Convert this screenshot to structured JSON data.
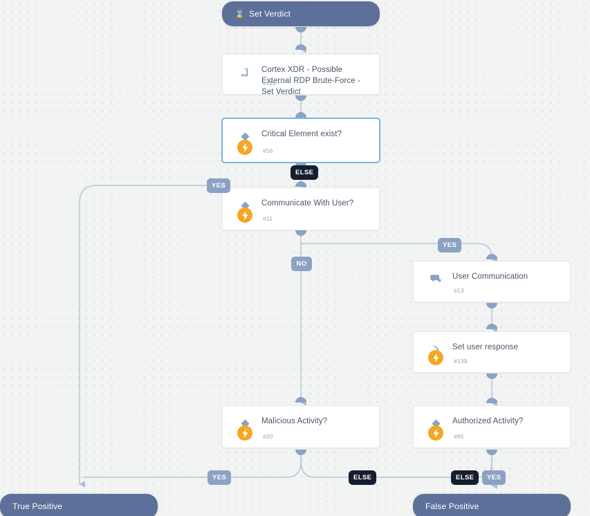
{
  "canvas": {
    "background_color": "#f2f4f3",
    "grid_dot_color": "#dcdfde",
    "edge_color": "#b8c9dd"
  },
  "start_node": {
    "label": "Set Verdict",
    "icon": "hourglass-icon",
    "color": "#5d7099"
  },
  "nodes": [
    {
      "id": "playbook-task",
      "title": "Cortex XDR - Possible External RDP Brute-Force - Set Verdict",
      "task_id": "#111",
      "icon": "playbook-book-icon",
      "has_bolt": false,
      "selected": false
    },
    {
      "id": "critical-element",
      "title": "Critical Element exist?",
      "task_id": "#56",
      "icon": "condition-diamond-icon",
      "has_bolt": true,
      "selected": true
    },
    {
      "id": "communicate-with-user",
      "title": "Communicate With User?",
      "task_id": "#11",
      "icon": "condition-diamond-icon",
      "has_bolt": true,
      "selected": false
    },
    {
      "id": "user-communication",
      "title": "User Communication",
      "task_id": "#13",
      "icon": "chat-bubble-icon",
      "has_bolt": false,
      "selected": false
    },
    {
      "id": "set-user-response",
      "title": "Set user response",
      "task_id": "#139",
      "icon": "chevron-right-icon",
      "has_bolt": true,
      "selected": false
    },
    {
      "id": "malicious-activity",
      "title": "Malicious Activity?",
      "task_id": "#20",
      "icon": "condition-diamond-icon",
      "has_bolt": true,
      "selected": false
    },
    {
      "id": "authorized-activity",
      "title": "Authorized Activity?",
      "task_id": "#85",
      "icon": "condition-diamond-icon",
      "has_bolt": true,
      "selected": false
    }
  ],
  "end_nodes": [
    {
      "id": "true-positive",
      "label": "True Positive",
      "color": "#5d7099"
    },
    {
      "id": "false-positive",
      "label": "False Positive",
      "color": "#5d7099"
    }
  ],
  "branch_badges": [
    {
      "id": "else-critical",
      "label": "ELSE",
      "kind": "else"
    },
    {
      "id": "yes-critical",
      "label": "YES",
      "kind": "yes"
    },
    {
      "id": "no-communicate",
      "label": "NO",
      "kind": "no"
    },
    {
      "id": "yes-communicate",
      "label": "YES",
      "kind": "yes"
    },
    {
      "id": "yes-malicious",
      "label": "YES",
      "kind": "yes"
    },
    {
      "id": "else-malicious",
      "label": "ELSE",
      "kind": "else"
    },
    {
      "id": "else-authorized",
      "label": "ELSE",
      "kind": "else"
    },
    {
      "id": "yes-authorized",
      "label": "YES",
      "kind": "yes"
    }
  ]
}
